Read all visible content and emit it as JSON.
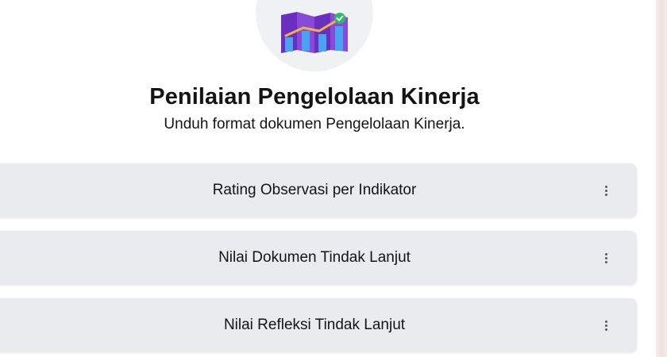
{
  "header": {
    "icon": "performance-map-chart-icon",
    "title": "Penilaian Pengelolaan Kinerja",
    "subtitle": "Unduh format dokumen Pengelolaan Kinerja."
  },
  "items": [
    {
      "label": "Rating Observasi per Indikator",
      "menu_icon": "more-vertical-icon"
    },
    {
      "label": "Nilai Dokumen Tindak Lanjut",
      "menu_icon": "more-vertical-icon"
    },
    {
      "label": "Nilai Refleksi Tindak Lanjut",
      "menu_icon": "more-vertical-icon"
    }
  ],
  "colors": {
    "card_background": "#e9ebee",
    "icon_purple": "#7d3fd0",
    "icon_blue": "#4aa3f0",
    "icon_check": "#2fb86a",
    "icon_line": "#f2b33d"
  }
}
